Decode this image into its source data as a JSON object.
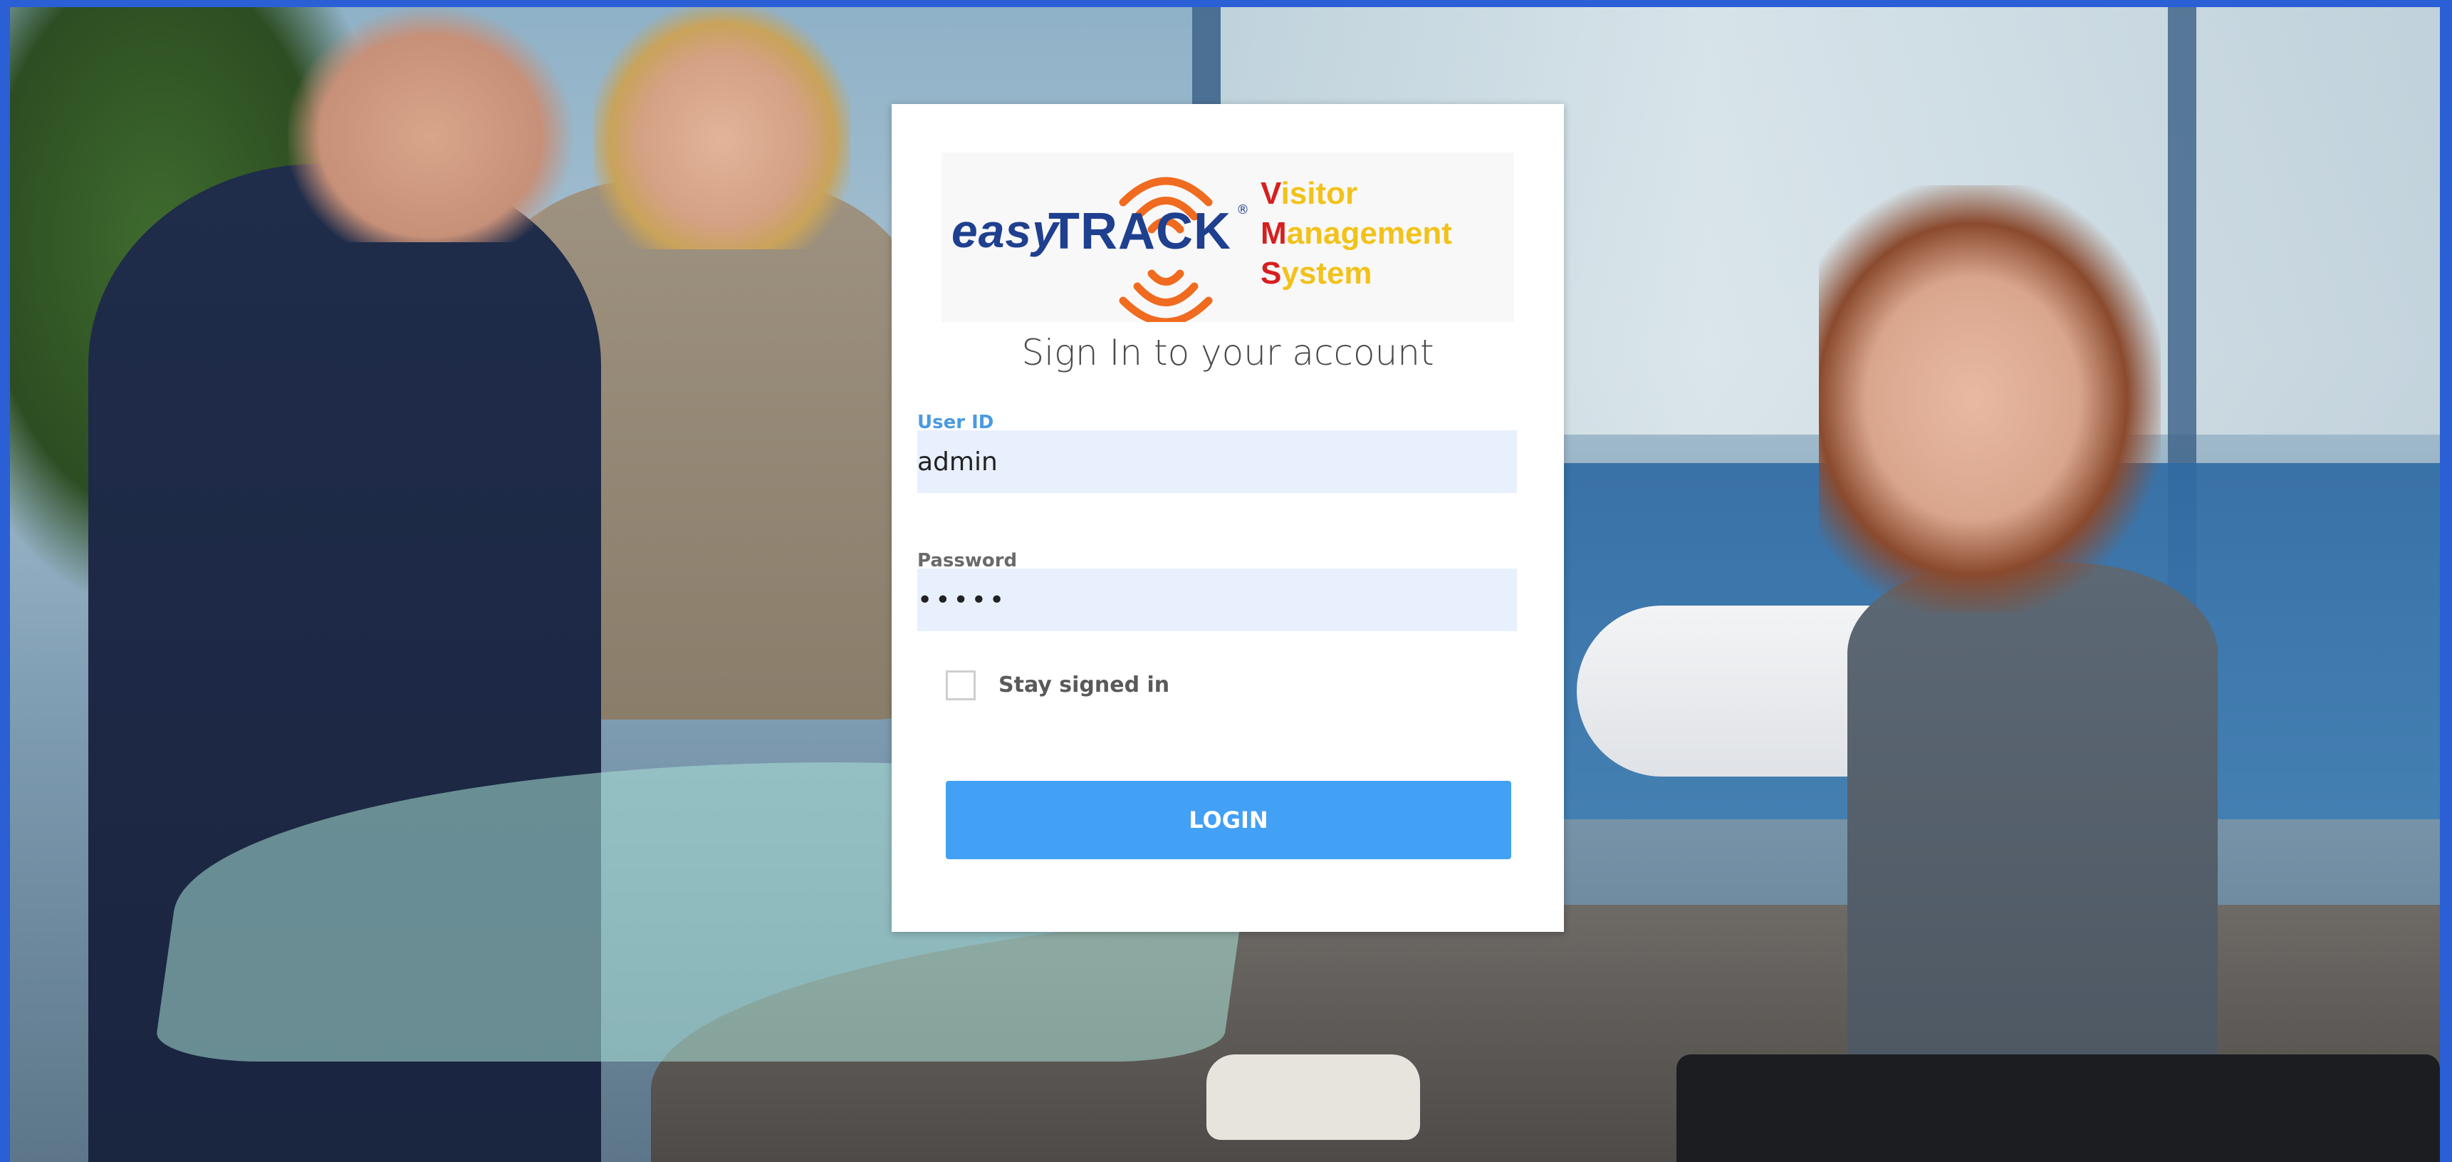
{
  "logo": {
    "brand_easy": "easy",
    "brand_track": "TRACK",
    "registered": "®",
    "vms_lines": [
      {
        "cap": "V",
        "rest": "isitor"
      },
      {
        "cap": "M",
        "rest": "anagement"
      },
      {
        "cap": "S",
        "rest": "ystem"
      }
    ]
  },
  "login": {
    "title": "Sign In to your account",
    "user_label": "User ID",
    "user_value": "admin",
    "password_label": "Password",
    "password_value": "•••••",
    "stay_signed_in_label": "Stay signed in",
    "stay_signed_in_checked": false,
    "login_button": "LOGIN"
  },
  "colors": {
    "frame": "#2a5fd6",
    "brand_blue": "#1f3f8f",
    "logo_orange": "#f06b1f",
    "vms_red": "#d61f1f",
    "vms_yellow": "#f2c21a",
    "button": "#42a0f5",
    "input_bg": "#e8f0fe"
  },
  "icons": {
    "logo_signal": "signal-waves-icon"
  }
}
